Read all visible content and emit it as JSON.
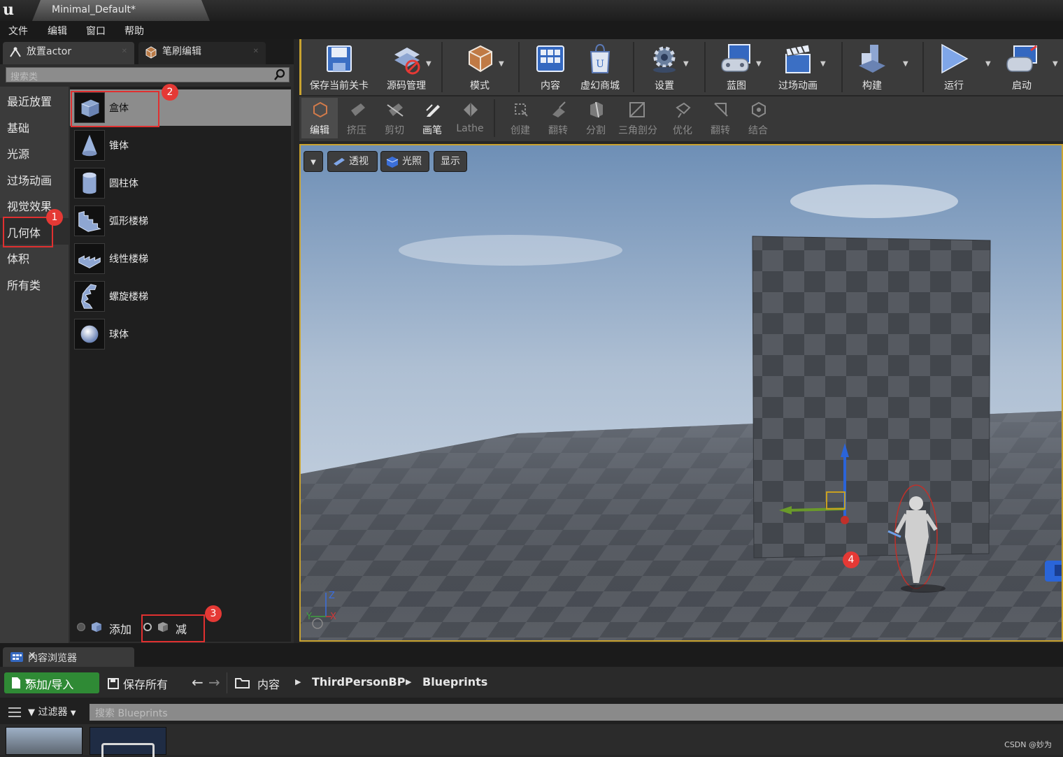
{
  "window": {
    "doc_tab": "Minimal_Default*"
  },
  "menu": [
    "文件",
    "编辑",
    "窗口",
    "帮助"
  ],
  "left_tabs": {
    "place_actor": "放置actor",
    "brush_edit": "笔刷编辑"
  },
  "search": {
    "placeholder": "搜索类"
  },
  "categories": [
    "最近放置",
    "基础",
    "光源",
    "过场动画",
    "视觉效果",
    "几何体",
    "体积",
    "所有类"
  ],
  "items": [
    "盒体",
    "锥体",
    "圆柱体",
    "弧形楼梯",
    "线性楼梯",
    "螺旋楼梯",
    "球体"
  ],
  "brush_mode": {
    "add": "添加",
    "subtract": "减"
  },
  "badges": [
    "1",
    "2",
    "3",
    "4"
  ],
  "toolbar": [
    "保存当前关卡",
    "源码管理",
    "模式",
    "内容",
    "虚幻商城",
    "设置",
    "蓝图",
    "过场动画",
    "构建",
    "运行",
    "启动"
  ],
  "toolbar2": [
    "编辑",
    "挤压",
    "剪切",
    "画笔",
    "Lathe",
    "创建",
    "翻转",
    "分割",
    "三角剖分",
    "优化",
    "翻转",
    "结合"
  ],
  "viewport": {
    "perspective": "透视",
    "lit": "光照",
    "show": "显示",
    "axis_z": "Z",
    "axis_y": "Y",
    "axis_x": "X"
  },
  "content_browser": {
    "tab": "内容浏览器",
    "add_import": "添加/导入",
    "save_all": "保存所有",
    "breadcrumbs": [
      "内容",
      "ThirdPersonBP",
      "Blueprints"
    ],
    "filter": "过滤器",
    "search_placeholder": "搜索 Blueprints"
  },
  "watermark": "CSDN @妙为",
  "colors": {
    "accent": "#c9a32f",
    "annotation": "#e53935",
    "add_button": "#2f8a35"
  }
}
